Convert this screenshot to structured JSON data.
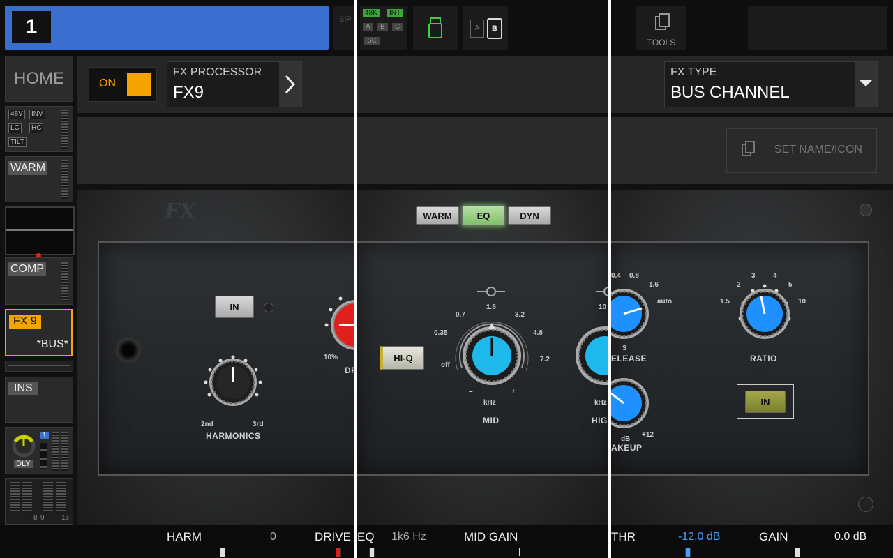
{
  "header": {
    "channel_number": "1",
    "sip_label": "SIP",
    "rate_48k": "48K",
    "int_label": "INT",
    "bus_a": "A",
    "bus_b": "B",
    "bus_c": "C",
    "sc_label": "SC",
    "card_a": "A",
    "card_b": "B",
    "tools_label": "TOOLS"
  },
  "sidebar": {
    "home": "HOME",
    "chips": [
      "48V",
      "INV",
      "LC",
      "HC",
      "TILT"
    ],
    "warm": "WARM",
    "comp": "COMP",
    "fx_slot": "FX 9",
    "fx_bus": "*BUS*",
    "ins": "INS",
    "dly": "DLY",
    "dly_badge": "1",
    "meter_scale_a": "8",
    "meter_scale_b": "9",
    "meter_scale_c": "16"
  },
  "fx_header": {
    "on_label": "ON",
    "processor_caption": "FX PROCESSOR",
    "processor_value": "FX9",
    "type_caption": "FX TYPE",
    "type_value": "BUS CHANNEL",
    "set_name_button": "SET NAME/ICON"
  },
  "plugin": {
    "logo": "FX",
    "left": {
      "in_button": "IN",
      "harmonics_label": "HARMONICS",
      "harm_2nd": "2nd",
      "harm_3rd": "3rd",
      "drive_min": "10%",
      "drive_partial": "DR"
    },
    "middle": {
      "tabs": [
        "WARM",
        "EQ",
        "DYN"
      ],
      "active_tab": "EQ",
      "hiq_button": "HI-Q",
      "mid_scale": [
        "off",
        "0.35",
        "0.7",
        "1.6",
        "3.2",
        "4.8",
        "7.2"
      ],
      "mid_minus": "–",
      "mid_plus": "+",
      "mid_unit": "kHz",
      "mid_label": "MID",
      "high_scale_top": "10",
      "high_unit": "kHz",
      "high_label_partial": "HIG"
    },
    "right": {
      "release_scale": [
        "0.4",
        "0.8",
        "1.6",
        "auto"
      ],
      "release_unit": "S",
      "release_label": "ELEASE",
      "ratio_scale": [
        "1.5",
        "2",
        "3",
        "4",
        "5",
        "10"
      ],
      "ratio_label": "RATIO",
      "in_button": "IN",
      "makeup_unit": "dB",
      "makeup_max": "+12",
      "makeup_label": "AKEUP"
    }
  },
  "params": {
    "harm_name": "HARM",
    "harm_value": "0",
    "drive_name": "DRIVE",
    "eq_name": "EQ",
    "eq_value": "1k6 Hz",
    "mid_gain_name": "MID GAIN",
    "thr_name": "THR",
    "thr_value": "-12.0 dB",
    "gain_name": "GAIN",
    "gain_value": "0.0 dB"
  },
  "colors": {
    "channel_bar": "#3a6fcf",
    "on_led": "#f5a300",
    "fx_slot_outline": "#f5a300",
    "knob_blue": "#1e90ff",
    "drive_red": "#e0201c",
    "thr_value_color": "#3fa0ff"
  }
}
